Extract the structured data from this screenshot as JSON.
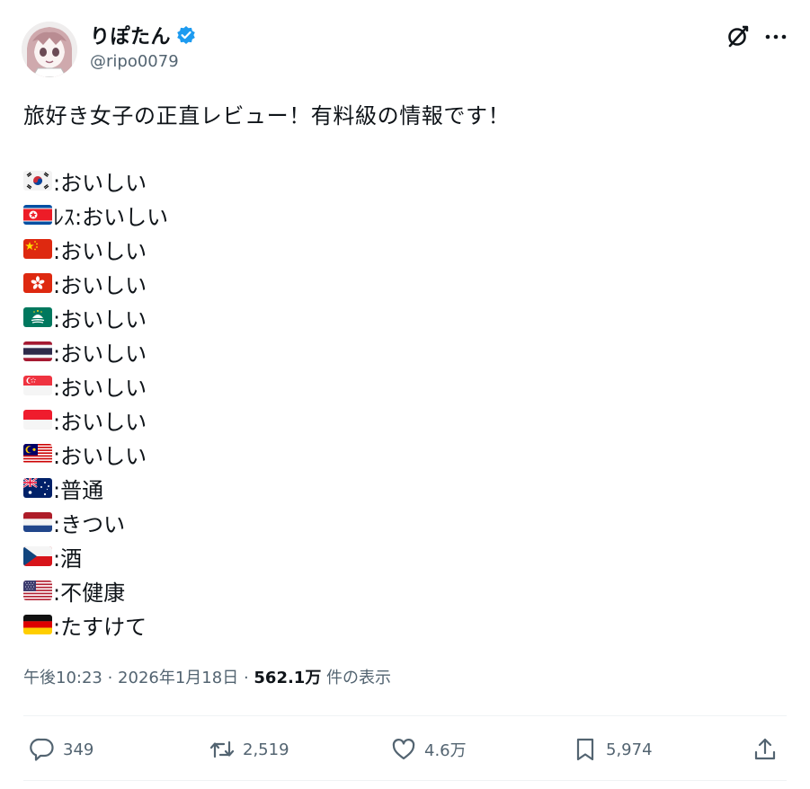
{
  "user": {
    "display_name": "りぽたん",
    "handle": "@ripo0079",
    "verified": true,
    "avatar_icon": "avatar-illustration"
  },
  "header_icons": [
    "grok-icon",
    "more-icon"
  ],
  "tweet": {
    "lead": "旅好き女子の正直レビュー！有料級の情報です！",
    "rows": [
      {
        "flag": "south-korea",
        "text": ":おいしい"
      },
      {
        "flag": "north-korea",
        "text": ":おいしい",
        "prefix": "ﾚｽ"
      },
      {
        "flag": "china",
        "text": ":おいしい"
      },
      {
        "flag": "hong-kong",
        "text": ":おいしい"
      },
      {
        "flag": "macau",
        "text": ":おいしい"
      },
      {
        "flag": "thailand",
        "text": ":おいしい"
      },
      {
        "flag": "singapore",
        "text": ":おいしい"
      },
      {
        "flag": "indonesia",
        "text": ":おいしい"
      },
      {
        "flag": "malaysia",
        "text": ":おいしい"
      },
      {
        "flag": "australia",
        "text": ":普通"
      },
      {
        "flag": "netherlands",
        "text": ":きつい"
      },
      {
        "flag": "czech",
        "text": ":酒"
      },
      {
        "flag": "usa",
        "text": ":不健康"
      },
      {
        "flag": "germany",
        "text": ":たすけて"
      }
    ]
  },
  "meta": {
    "time": "午後10:23",
    "sep": " · ",
    "date": "2026年1月18日",
    "views_count": "562.1万",
    "views_label": " 件の表示"
  },
  "actions": {
    "replies": "349",
    "reposts": "2,519",
    "likes": "4.6万",
    "bookmarks": "5,974"
  },
  "colors": {
    "text": "#0f1419",
    "secondary": "#536471",
    "verified": "#1d9bf0",
    "divider": "#eff3f4"
  }
}
